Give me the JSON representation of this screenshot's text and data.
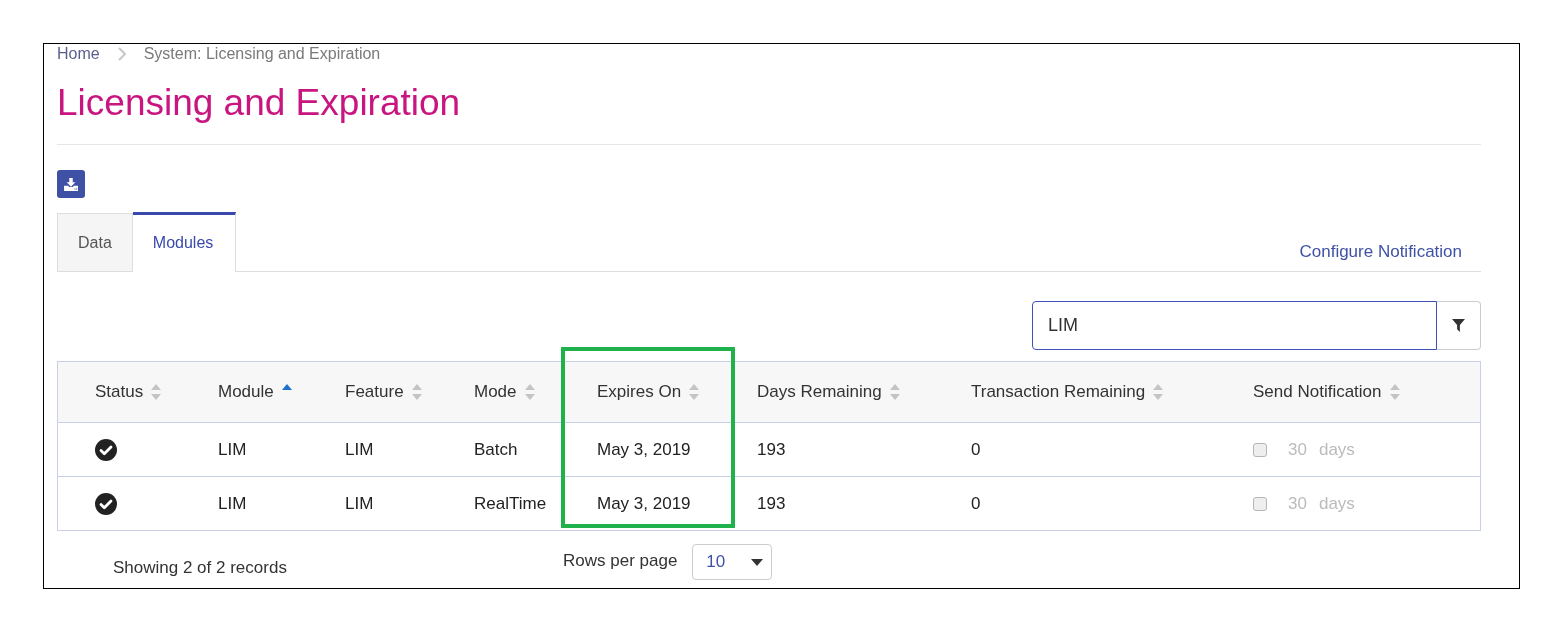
{
  "breadcrumb": [
    {
      "label": "Home",
      "kind": "link"
    },
    {
      "label": "System: Licensing and Expiration",
      "kind": "current"
    }
  ],
  "title": "Licensing and Expiration",
  "tabs": [
    {
      "label": "Data",
      "selected": false
    },
    {
      "label": "Modules",
      "selected": true
    }
  ],
  "configure_link": "Configure Notification",
  "search": {
    "value": "LIM"
  },
  "table": {
    "columns": [
      {
        "label": "Status",
        "sorted": false,
        "highlighted": false
      },
      {
        "label": "Module",
        "sorted": true,
        "highlighted": false
      },
      {
        "label": "Feature",
        "sorted": false,
        "highlighted": false
      },
      {
        "label": "Mode",
        "sorted": false,
        "highlighted": false
      },
      {
        "label": "Expires On",
        "sorted": false,
        "highlighted": true
      },
      {
        "label": "Days Remaining",
        "sorted": false,
        "highlighted": false
      },
      {
        "label": "Transaction Remaining",
        "sorted": false,
        "highlighted": false
      },
      {
        "label": "Send Notification",
        "sorted": false,
        "highlighted": false
      }
    ],
    "rows": [
      {
        "active": true,
        "cells": [
          "",
          "LIM",
          "LIM",
          "Batch",
          "May 3, 2019",
          "193",
          "0"
        ],
        "notification": {
          "checked": false,
          "disabled": true,
          "value": "30",
          "unit": "days"
        }
      },
      {
        "active": true,
        "cells": [
          "",
          "LIM",
          "LIM",
          "RealTime",
          "May 3, 2019",
          "193",
          "0"
        ],
        "notification": {
          "checked": false,
          "disabled": true,
          "value": "30",
          "unit": "days"
        }
      }
    ]
  },
  "footer": {
    "records": "Showing 2 of 2 records",
    "rows_per_page_label": "Rows per page",
    "rows_per_page": "10"
  }
}
